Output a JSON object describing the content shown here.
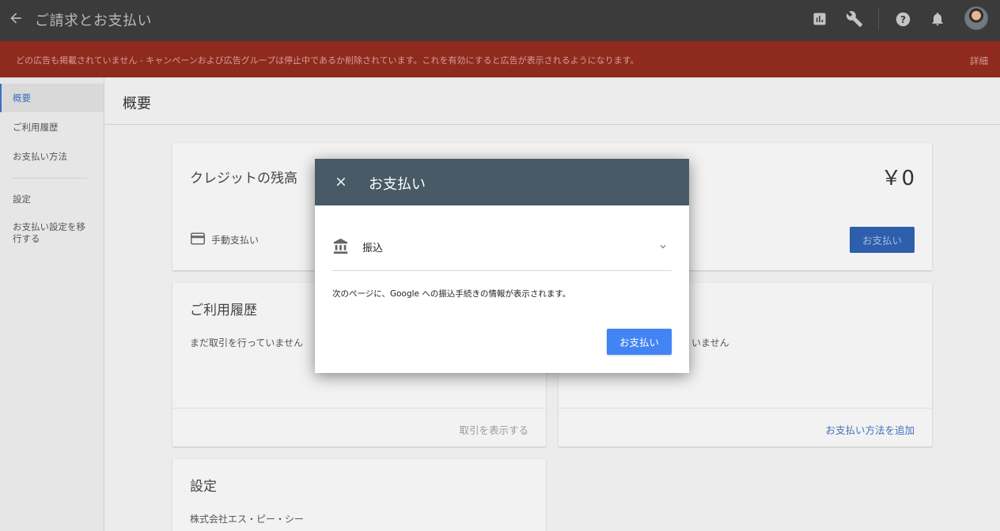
{
  "topbar": {
    "title": "ご請求とお支払い",
    "icons": [
      "back-arrow-icon",
      "reports-icon",
      "tools-icon",
      "help-icon",
      "notifications-icon",
      "avatar"
    ]
  },
  "alert": {
    "message": "どの広告も掲載されていません - キャンペーンおよび広告グループは停止中であるか削除されています。これを有効にすると広告が表示されるようになります。",
    "link": "詳細"
  },
  "sidebar": {
    "items": [
      {
        "label": "概要",
        "active": true
      },
      {
        "label": "ご利用履歴"
      },
      {
        "label": "お支払い方法"
      },
      {
        "label": "設定"
      },
      {
        "label": "お支払い設定を移行する"
      }
    ]
  },
  "page": {
    "title": "概要"
  },
  "balance_card": {
    "title": "クレジットの残高",
    "amount": "￥0",
    "payment_type": "手動支払い",
    "button": "お支払い"
  },
  "history_card": {
    "title": "ご利用履歴",
    "empty_text": "まだ取引を行っていません",
    "link": "取引を表示する"
  },
  "methods_card": {
    "partial_text": "いません",
    "link": "お支払い方法を追加"
  },
  "settings_card": {
    "title": "設定",
    "company": "株式会社エス・ピー・シー"
  },
  "dialog": {
    "title": "お支払い",
    "method": "振込",
    "info": "次のページに、Google への振込手続きの情報が表示されます。",
    "button": "お支払い"
  },
  "colors": {
    "topbar": "#3b3b3b",
    "alert": "#8e2a1e",
    "dialog_header": "#475a65",
    "primary_button": "#4384f5",
    "link": "#3f6fbf"
  }
}
